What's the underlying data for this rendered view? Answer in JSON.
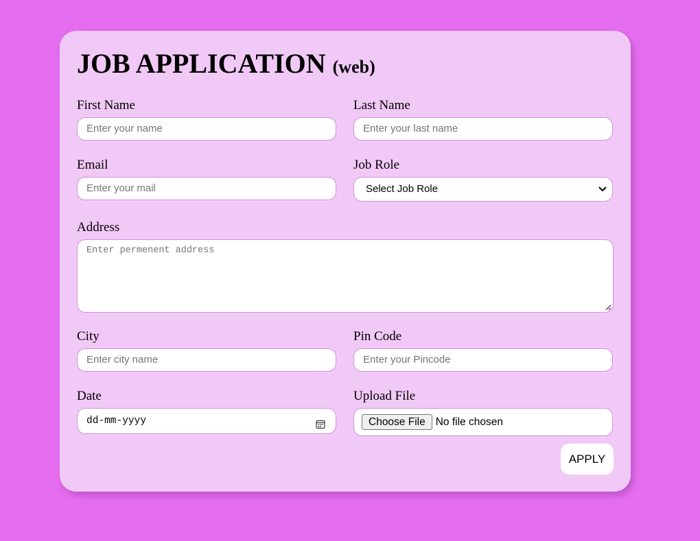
{
  "theme": {
    "background": "#e56ef0",
    "card": "#f1c9f6",
    "field_border": "#d48fe0"
  },
  "header": {
    "title": "JOB APPLICATION",
    "subtitle": "(web)"
  },
  "form": {
    "first_name": {
      "label": "First Name",
      "placeholder": "Enter your name"
    },
    "last_name": {
      "label": "Last Name",
      "placeholder": "Enter your last name"
    },
    "email": {
      "label": "Email",
      "placeholder": "Enter your mail"
    },
    "job_role": {
      "label": "Job Role",
      "selected": "Select Job Role"
    },
    "address": {
      "label": "Address",
      "placeholder": "Enter permenent address"
    },
    "city": {
      "label": "City",
      "placeholder": "Enter city name"
    },
    "pin_code": {
      "label": "Pin Code",
      "placeholder": "Enter your Pincode"
    },
    "date": {
      "label": "Date",
      "placeholder": "dd-mm-yyyy",
      "icon": "calendar-icon"
    },
    "upload": {
      "label": "Upload File",
      "button": "Choose File",
      "status": "No file chosen"
    },
    "submit": {
      "label": "APPLY"
    }
  }
}
